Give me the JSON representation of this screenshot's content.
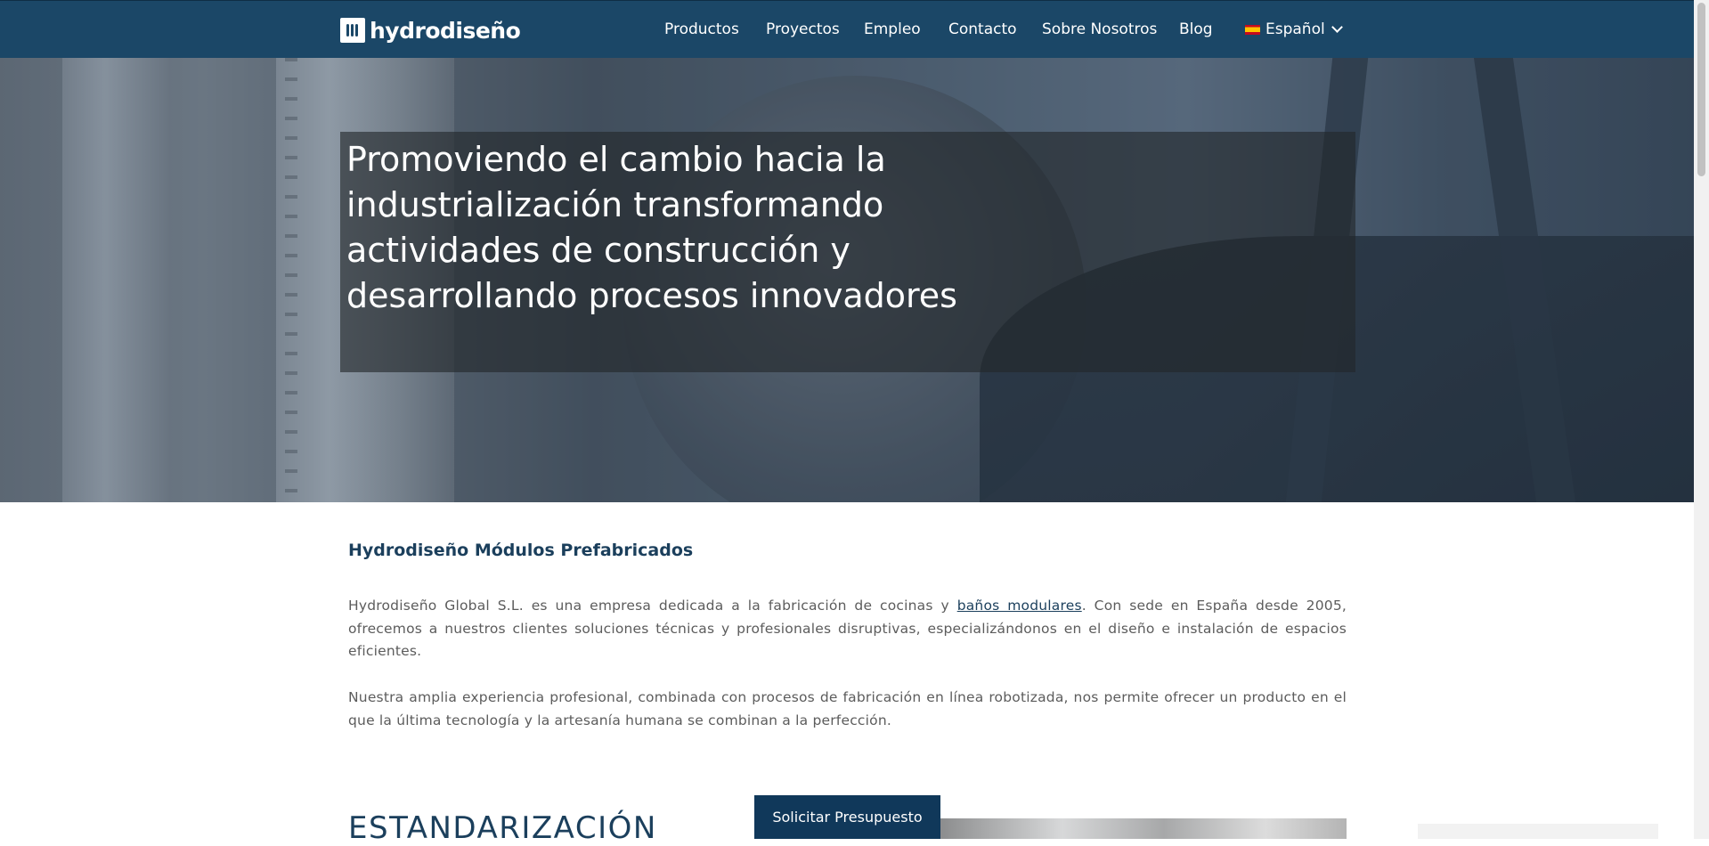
{
  "header": {
    "logo_text": "hydrodiseño",
    "nav": [
      {
        "label": "Productos"
      },
      {
        "label": "Proyectos"
      },
      {
        "label": "Empleo"
      },
      {
        "label": "Contacto"
      },
      {
        "label": "Sobre Nosotros"
      },
      {
        "label": "Blog"
      }
    ],
    "language": {
      "label": "Español",
      "flag": "spain-flag-icon"
    }
  },
  "hero": {
    "title": "Promoviendo el cambio hacia la industrialización transformando actividades de construcción y desarrollando procesos innovadores"
  },
  "intro": {
    "heading": "Hydrodiseño Módulos Prefabricados",
    "p1_before": "Hydrodiseño Global S.L. es una empresa dedicada a la fabricación de cocinas y ",
    "p1_link": "baños modulares",
    "p1_after": ". Con sede en España desde 2005, ofrecemos a nuestros clientes soluciones técnicas y profesionales disruptivas, especializándonos en el diseño e instalación de espacios eficientes.",
    "p2": "Nuestra amplia experiencia profesional, combinada con procesos de fabricación en línea robotizada, nos permite ofrecer un producto en el que la última tecnología y la artesanía humana se combinan a la perfección."
  },
  "section2": {
    "heading": "ESTANDARIZACIÓN"
  },
  "cta": {
    "label": "Solicitar Presupuesto"
  },
  "colors": {
    "header_bg": "#1b4767",
    "accent": "#1b3f5c",
    "cta_bg": "#10385a"
  }
}
